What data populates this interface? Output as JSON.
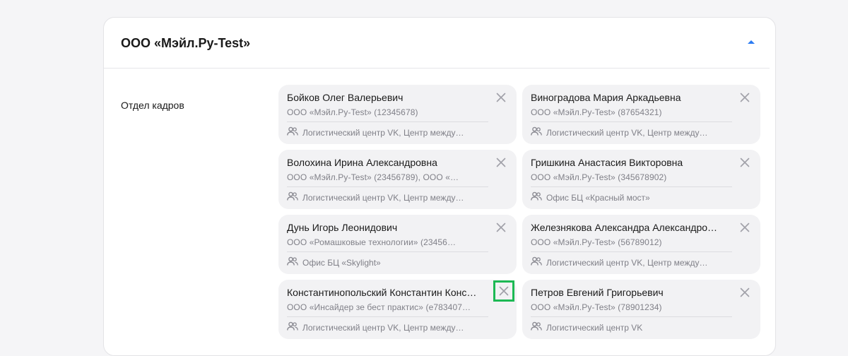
{
  "org": {
    "title": "ООО «Мэйл.Ру-Test»",
    "collapse_icon": "chevron-up-icon",
    "accent": "#2b7bf2"
  },
  "department": {
    "label": "Отдел кадров"
  },
  "members": [
    {
      "name": "Бойков Олег Валерьевич",
      "org": "ООО «Мэйл.Ру-Test» (12345678)",
      "location": "Логистический центр VK, Центр между…"
    },
    {
      "name": "Виноградова Мария Аркадьевна",
      "org": "ООО «Мэйл.Ру-Test» (87654321)",
      "location": "Логистический центр VK, Центр между…"
    },
    {
      "name": "Волохина Ирина Александровна",
      "org": "ООО «Мэйл.Ру-Test» (23456789), ООО «…",
      "location": "Логистический центр VK, Центр между…"
    },
    {
      "name": "Гришкина Анастасия Викторовна",
      "org": "ООО «Мэйл.Ру-Test» (345678902)",
      "location": "Офис БЦ «Красный мост»"
    },
    {
      "name": "Дунь Игорь Леонидович",
      "org": "ООО «Ромашковые технологии» (23456…",
      "location": "Офис БЦ «Skylight»"
    },
    {
      "name": "Железнякова Александра Александро…",
      "org": "ООО «Мэйл.Ру-Test» (56789012)",
      "location": "Логистический центр VK, Центр между…"
    },
    {
      "name": "Константинопольский Константин Конс…",
      "org": "ООО «Инсайдер зе бест практис» (e783407…",
      "location": "Логистический центр VK, Центр между…"
    },
    {
      "name": "Петров Евгений Григорьевич",
      "org": "ООО «Мэйл.Ру-Test» (78901234)",
      "location": "Логистический центр VK"
    }
  ],
  "icons": {
    "remove": "close-icon",
    "location": "users-icon"
  },
  "colors": {
    "focus_highlight": "#1db954",
    "card_bg": "#f2f2f4"
  }
}
